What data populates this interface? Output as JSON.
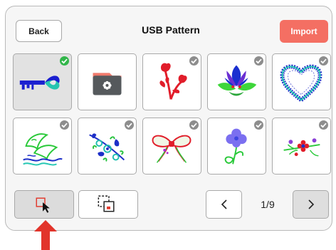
{
  "header": {
    "back_label": "Back",
    "title": "USB Pattern",
    "import_label": "Import"
  },
  "patterns": [
    {
      "name": "key-heart",
      "selected": true
    },
    {
      "name": "folder",
      "selected": false
    },
    {
      "name": "red-rose",
      "selected": false
    },
    {
      "name": "lotus",
      "selected": false
    },
    {
      "name": "lace-heart",
      "selected": false
    },
    {
      "name": "dolphins",
      "selected": false
    },
    {
      "name": "floral-corner",
      "selected": false
    },
    {
      "name": "bow",
      "selected": false
    },
    {
      "name": "clover-flower",
      "selected": false
    },
    {
      "name": "flower-sprig",
      "selected": false
    }
  ],
  "footer": {
    "page_indicator": "1/9",
    "prev_icon": "chevron-left-icon",
    "next_icon": "chevron-right-icon",
    "select_tool_icon": "select-square-icon",
    "multi_select_tool_icon": "multi-select-icon"
  },
  "colors": {
    "accent": "#f46f63",
    "check_selected": "#31b64a",
    "check_unselected": "#8d8d8d",
    "annotation_arrow": "#e2342b"
  }
}
